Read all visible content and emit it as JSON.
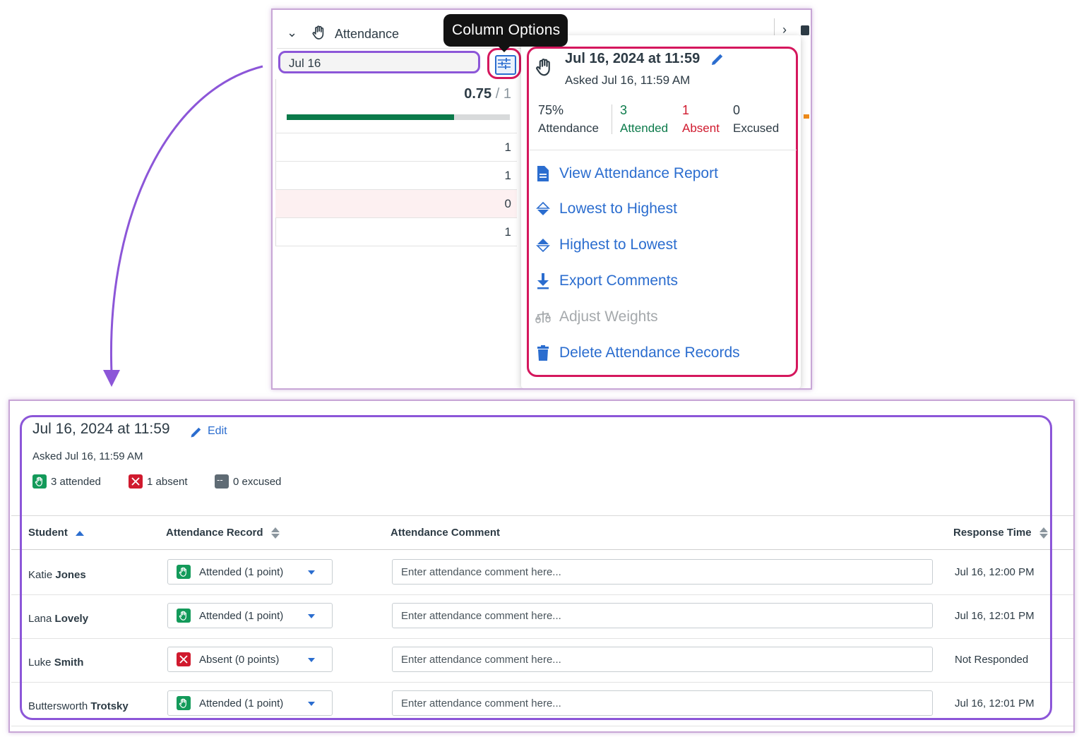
{
  "tooltip": {
    "text": "Column Options"
  },
  "column": {
    "title": "Attendance",
    "date_label": "Jul 16",
    "score": "0.75",
    "score_denominator": "/ 1",
    "progress_fraction": 0.75,
    "row_values": [
      "1",
      "1",
      "0",
      "1"
    ]
  },
  "popup": {
    "title": "Jul 16, 2024 at 11:59",
    "asked": "Asked Jul 16, 11:59 AM",
    "stats": {
      "rate_value": "75%",
      "rate_label": "Attendance",
      "attended_value": "3",
      "attended_label": "Attended",
      "absent_value": "1",
      "absent_label": "Absent",
      "excused_value": "0",
      "excused_label": "Excused"
    },
    "menu": [
      {
        "label": "View Attendance Report",
        "icon": "document-icon"
      },
      {
        "label": "Lowest to Highest",
        "icon": "sort-icon"
      },
      {
        "label": "Highest to Lowest",
        "icon": "sort-icon"
      },
      {
        "label": "Export Comments",
        "icon": "download-icon"
      },
      {
        "label": "Adjust Weights",
        "icon": "scale-icon",
        "disabled": true
      },
      {
        "label": "Delete Attendance Records",
        "icon": "trash-icon"
      }
    ]
  },
  "detail": {
    "title": "Jul 16, 2024 at 11:59",
    "edit_label": "Edit",
    "asked": "Asked Jul 16, 11:59 AM",
    "badges": {
      "attended": "3 attended",
      "absent": "1 absent",
      "excused": "0 excused",
      "excused_glyph": "--"
    },
    "headers": {
      "student": "Student",
      "record": "Attendance Record",
      "comment": "Attendance Comment",
      "response_time": "Response Time"
    },
    "comment_placeholder": "Enter attendance comment here...",
    "rows": [
      {
        "first": "Katie",
        "last": "Jones",
        "status": "attended",
        "record": "Attended (1 point)",
        "time": "Jul 16, 12:00 PM"
      },
      {
        "first": "Lana",
        "last": "Lovely",
        "status": "attended",
        "record": "Attended (1 point)",
        "time": "Jul 16, 12:01 PM"
      },
      {
        "first": "Luke",
        "last": "Smith",
        "status": "absent",
        "record": "Absent (0 points)",
        "time": "Not Responded"
      },
      {
        "first": "Buttersworth",
        "last": "Trotsky",
        "status": "attended",
        "record": "Attended (1 point)",
        "time": "Jul 16, 12:01 PM"
      }
    ]
  },
  "colors": {
    "primary": "#2b6dcf",
    "attended": "#0b7a4a",
    "absent": "#d01a2e",
    "highlight_purple": "#8c56d8",
    "highlight_pink": "#d5175d"
  }
}
